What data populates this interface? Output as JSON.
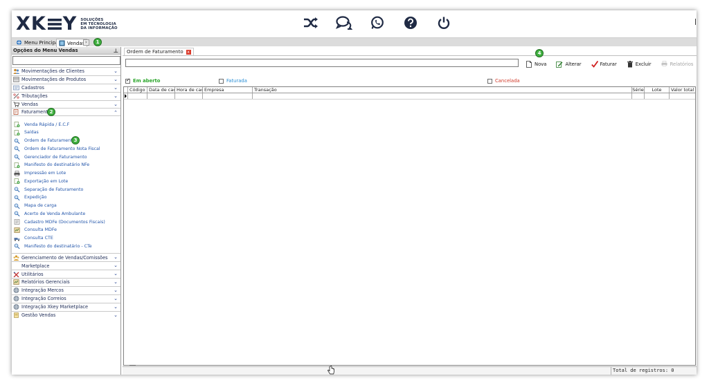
{
  "logo": {
    "brand_left": "XK",
    "brand_right": "Y",
    "tagline": [
      "SOLUÇÕES",
      "EM TECNOLOGIA",
      "DA INFORMAÇÃO"
    ]
  },
  "header_icons": [
    "shuffle-icon",
    "chat-icon",
    "whatsapp-icon",
    "help-icon",
    "power-icon"
  ],
  "tabs": {
    "menu_principal": "Menu Principal",
    "vendas": "Vendas",
    "close_glyph": "×"
  },
  "badges": [
    "1",
    "2",
    "3",
    "4"
  ],
  "sidebar": {
    "title": "Opções do Menu Vendas",
    "pin_glyph": "⊥",
    "categories_top": [
      {
        "label": "Movimentações de Clientes",
        "icon": "clients-icon"
      },
      {
        "label": "Movimentações de Produtos",
        "icon": "products-icon"
      },
      {
        "label": "Cadastros",
        "icon": "register-icon"
      },
      {
        "label": "Tributações",
        "icon": "percent-icon"
      },
      {
        "label": "Vendas",
        "icon": "cart-icon"
      }
    ],
    "faturamento": {
      "label": "Faturamento",
      "icon": "invoice-icon"
    },
    "subitems": [
      {
        "label": "Venda Rápida / E.C.F",
        "icon": "add-doc-icon"
      },
      {
        "label": "Saídas",
        "icon": "add-doc-icon"
      },
      {
        "label": "Ordem de Faturamento",
        "icon": "magnifier-icon"
      },
      {
        "label": "Ordem de Faturamento Nota Fiscal",
        "icon": "magnifier-icon"
      },
      {
        "label": "Gerenciador de Faturamento",
        "icon": "magnifier-icon"
      },
      {
        "label": "Manifesto do destinatário NFe",
        "icon": "add-doc-icon"
      },
      {
        "label": "Impressão em Lote",
        "icon": "printer-icon"
      },
      {
        "label": "Exportação em Lote",
        "icon": "add-doc-icon"
      },
      {
        "label": "Separação de Faturamento",
        "icon": "magnifier-icon"
      },
      {
        "label": "Expedição",
        "icon": "magnifier-icon"
      },
      {
        "label": "Mapa de carga",
        "icon": "magnifier-icon"
      },
      {
        "label": "Acerto de Venda Ambulante",
        "icon": "magnifier-icon"
      },
      {
        "label": "Cadastro MDFe (Documentos Fiscais)",
        "icon": "document-icon"
      },
      {
        "label": "Consulta MDFe",
        "icon": "report-icon"
      },
      {
        "label": "Consulta CTE",
        "icon": "truck-icon"
      },
      {
        "label": "Manifesto do destinatário - CTe",
        "icon": "magnifier-icon"
      }
    ],
    "categories_bottom": [
      {
        "label": "Gerenciamento de Vendas/Comissões",
        "icon": "people-icon"
      },
      {
        "label": "Marketplace",
        "icon": ""
      },
      {
        "label": "Utilitários",
        "icon": "tools-icon"
      },
      {
        "label": "Relatórios Gerenciais",
        "icon": "report-icon"
      },
      {
        "label": "Integração Mercos",
        "icon": "globe-icon"
      },
      {
        "label": "Integração Correios",
        "icon": "globe-icon"
      },
      {
        "label": "Integração Xkey Marketplace",
        "icon": "globe-icon"
      },
      {
        "label": "Gestão Vendas",
        "icon": "note-icon"
      }
    ],
    "chevron_down": "⌄",
    "chevron_up": "⌃"
  },
  "document_tab": {
    "label": "Ordem de Faturamento",
    "close_glyph": "x"
  },
  "toolbar": [
    {
      "label": "Nova",
      "icon": "new-doc-icon",
      "disabled": false
    },
    {
      "label": "Alterar",
      "icon": "edit-icon",
      "disabled": false
    },
    {
      "label": "Faturar",
      "icon": "check-icon",
      "disabled": false
    },
    {
      "label": "Excluir",
      "icon": "trash-icon",
      "disabled": false
    },
    {
      "label": "Relatórios",
      "icon": "printer-icon",
      "disabled": true
    }
  ],
  "filters": {
    "em_aberto": {
      "label": "Em aberto",
      "checked": true
    },
    "faturada": {
      "label": "Faturada",
      "checked": false
    },
    "cancelada": {
      "label": "Cancelada",
      "checked": false
    }
  },
  "grid": {
    "columns": [
      "Código",
      "Data de cad.",
      "Hora de cad.",
      "Empresa",
      "Transação",
      "Série",
      "Lote",
      "Valor total"
    ]
  },
  "status": {
    "total_label": "Total de registros: 0"
  },
  "colors": {
    "brand": "#1f2a44",
    "badge_green": "#41b041",
    "link_blue": "#2255aa",
    "open_green": "#2aa52a",
    "billed_blue": "#2b8fd6",
    "cancel_red": "#d03a2a"
  }
}
